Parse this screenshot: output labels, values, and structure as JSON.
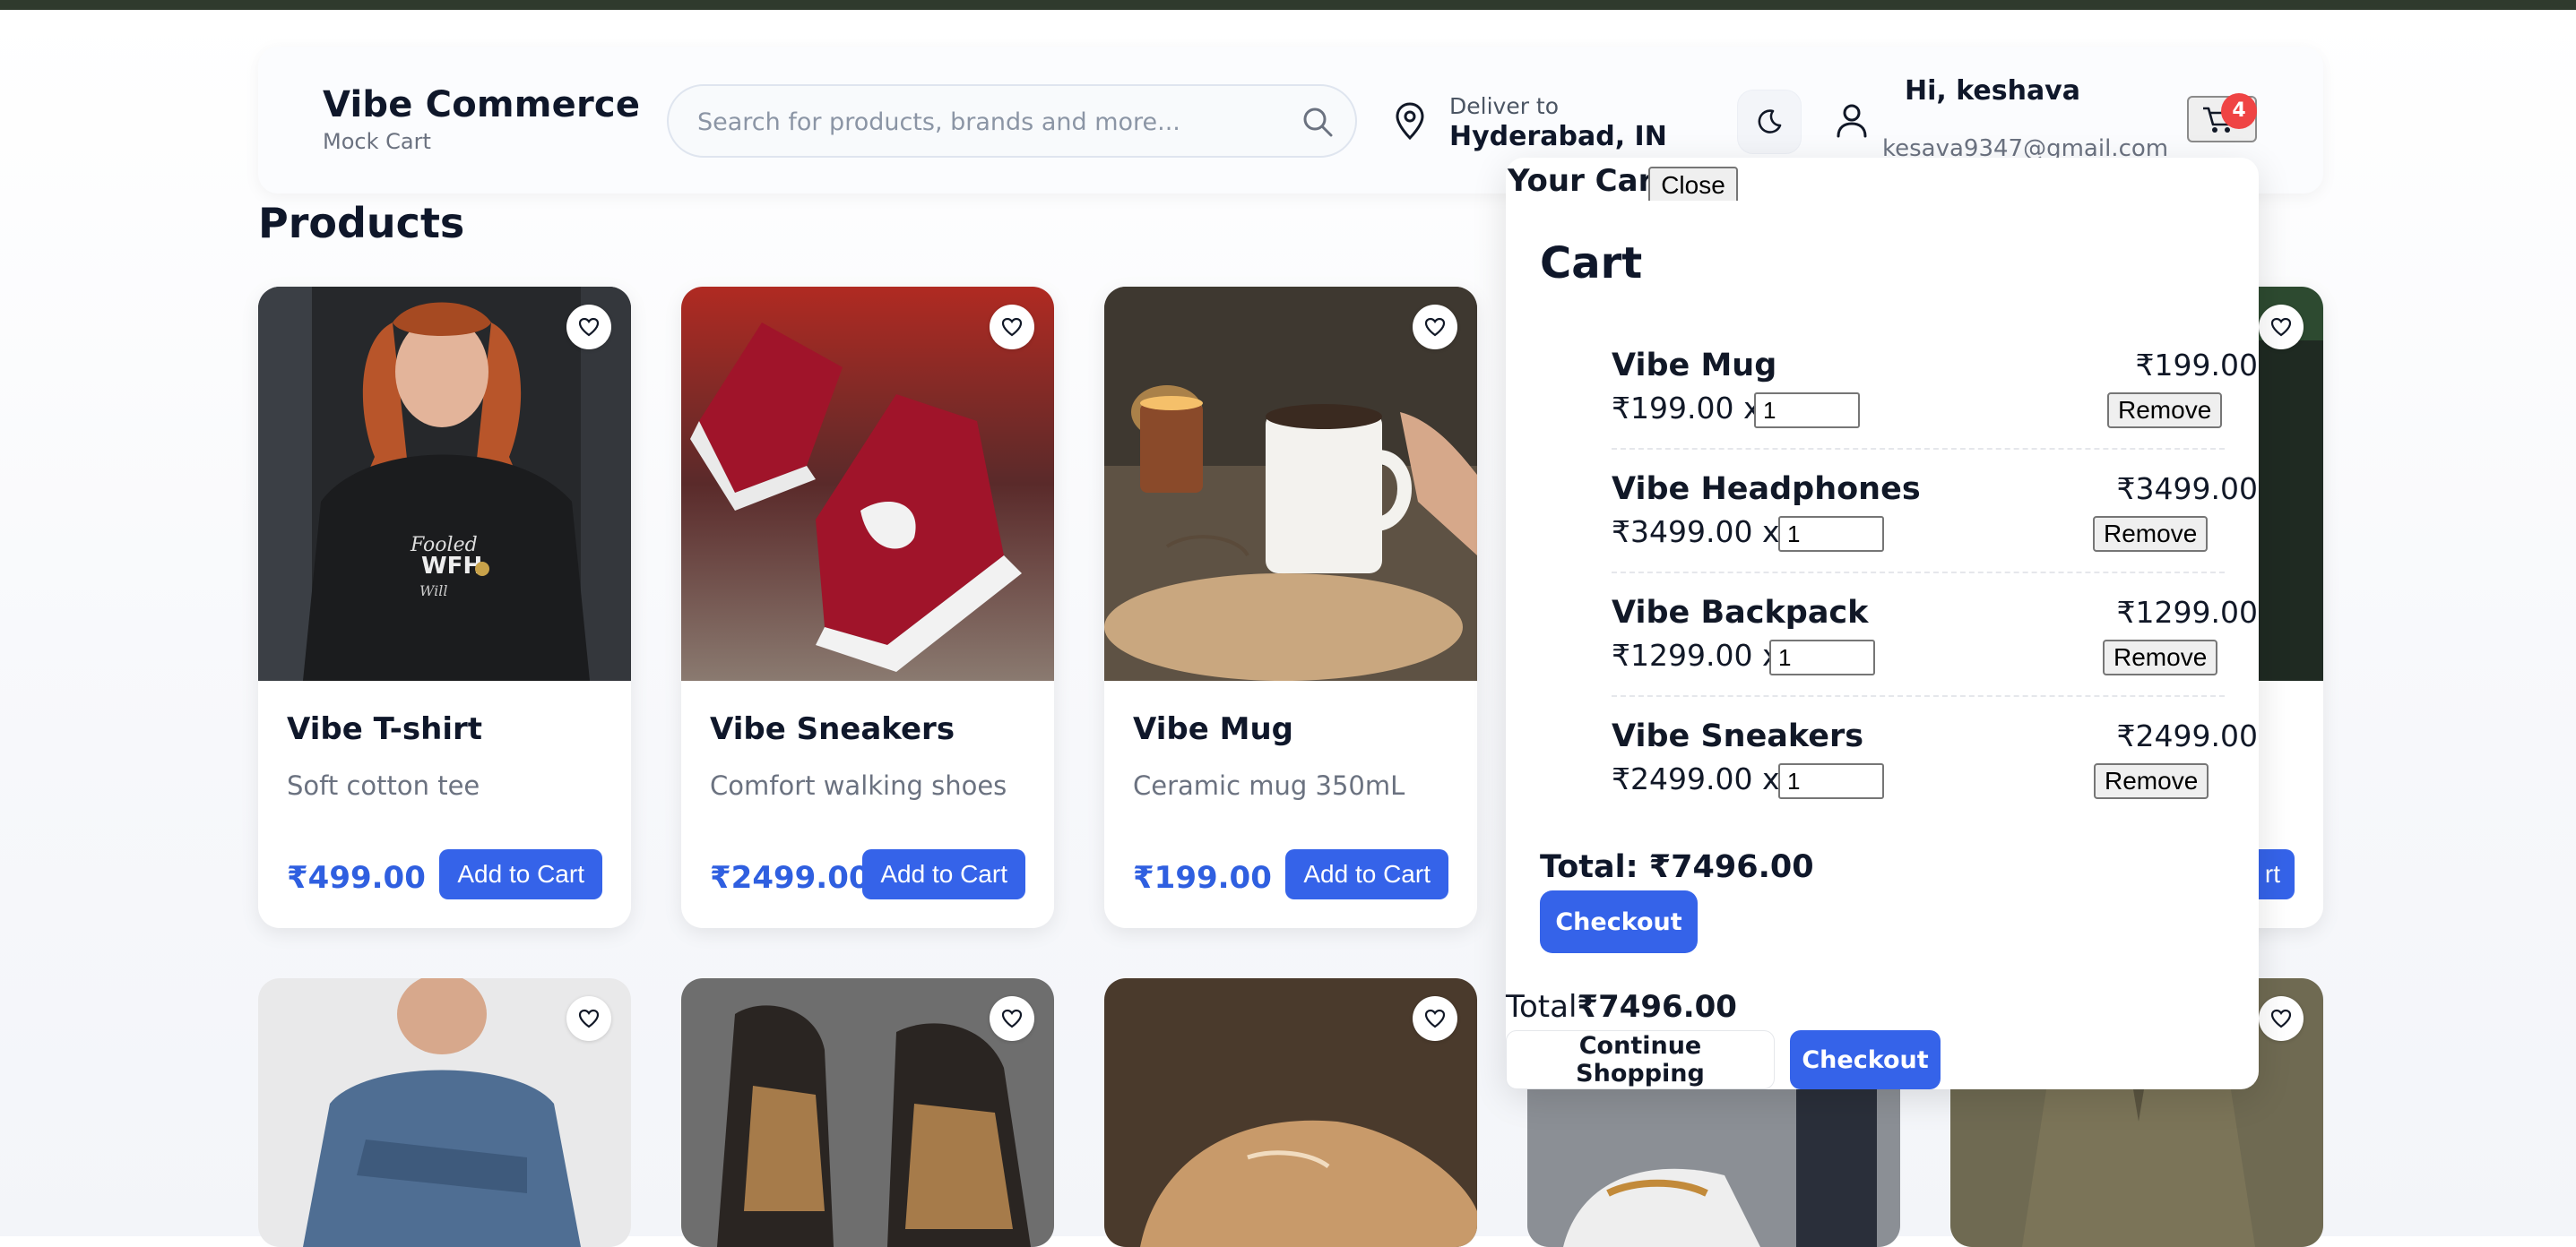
{
  "header": {
    "brand_title": "Vibe Commerce",
    "brand_subtitle": "Mock Cart",
    "search_placeholder": "Search for products, brands and more...",
    "deliver_label": "Deliver to",
    "deliver_location": "Hyderabad, IN",
    "greeting": "Hi, keshava",
    "email": "kesava9347@gmail.com",
    "cart_count": "4",
    "icons": [
      "search-icon",
      "location-pin-icon",
      "moon-icon",
      "user-icon",
      "cart-icon"
    ]
  },
  "products_title": "Products",
  "products": [
    {
      "name": "Vibe T-shirt",
      "description": "Soft cotton tee",
      "price": "₹499.00",
      "button": "Add to Cart"
    },
    {
      "name": "Vibe Sneakers",
      "description": "Comfort walking shoes",
      "price": "₹2499.00",
      "button": "Add to Cart"
    },
    {
      "name": "Vibe Mug",
      "description": "Ceramic mug 350mL",
      "price": "₹199.00",
      "button": "Add to Cart"
    }
  ],
  "partial_card_button": "rt",
  "cart": {
    "drawer_title": "Your Cart",
    "close_label": "Close",
    "heading": "Cart",
    "items": [
      {
        "name": "Vibe Mug",
        "unit": "₹199.00 x",
        "qty": "1",
        "total": "₹199.00",
        "remove": "Remove"
      },
      {
        "name": "Vibe Headphones",
        "unit": "₹3499.00 x",
        "qty": "1",
        "total": "₹3499.00",
        "remove": "Remove"
      },
      {
        "name": "Vibe Backpack",
        "unit": "₹1299.00 x",
        "qty": "1",
        "total": "₹1299.00",
        "remove": "Remove"
      },
      {
        "name": "Vibe Sneakers",
        "unit": "₹2499.00 x",
        "qty": "1",
        "total": "₹2499.00",
        "remove": "Remove"
      }
    ],
    "total_text": "Total: ₹7496.00",
    "checkout_label": "Checkout",
    "footer_total_label": "Total",
    "footer_total_value": "₹7496.00",
    "continue_label": "Continue Shopping",
    "footer_checkout_label": "Checkout"
  },
  "colors": {
    "accent": "#3563e9",
    "price": "#2f5fe0",
    "badge": "#ef4444",
    "topbar": "#2f3a2d"
  }
}
